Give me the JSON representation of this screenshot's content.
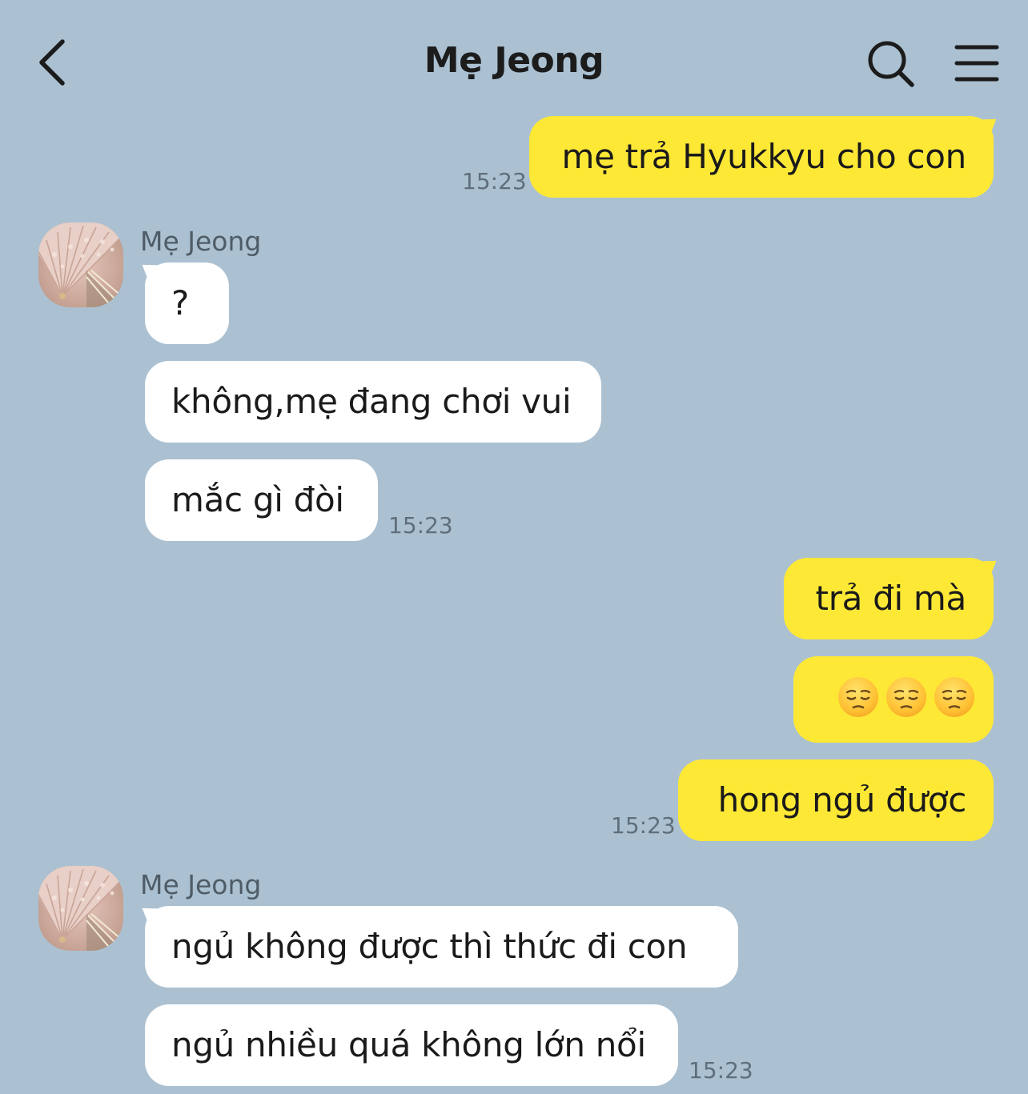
{
  "header": {
    "title": "Mẹ Jeong",
    "back_icon": "chevron-left-icon",
    "search_icon": "search-icon",
    "menu_icon": "hamburger-menu-icon"
  },
  "colors": {
    "background": "#abc1d2",
    "outgoing_bubble": "#fee836",
    "incoming_bubble": "#ffffff",
    "timestamp": "#5f6e7a"
  },
  "messages": [
    {
      "direction": "outgoing",
      "text": "mẹ trả Hyukkyu cho con",
      "time": "15:23"
    },
    {
      "direction": "incoming",
      "sender": "Mẹ Jeong",
      "text": "?"
    },
    {
      "direction": "incoming",
      "text": "không,mẹ đang chơi vui"
    },
    {
      "direction": "incoming",
      "text": "mắc gì đòi",
      "time": "15:23"
    },
    {
      "direction": "outgoing",
      "text": "trả đi mà"
    },
    {
      "direction": "outgoing",
      "emoji": [
        "pensive-face-emoji",
        "pensive-face-emoji",
        "pensive-face-emoji"
      ]
    },
    {
      "direction": "outgoing",
      "text": "hong ngủ được",
      "time": "15:23"
    },
    {
      "direction": "incoming",
      "sender": "Mẹ Jeong",
      "text": "ngủ không được thì thức đi con"
    },
    {
      "direction": "incoming",
      "text": "ngủ nhiều quá không lớn nổi",
      "time": "15:23"
    }
  ]
}
